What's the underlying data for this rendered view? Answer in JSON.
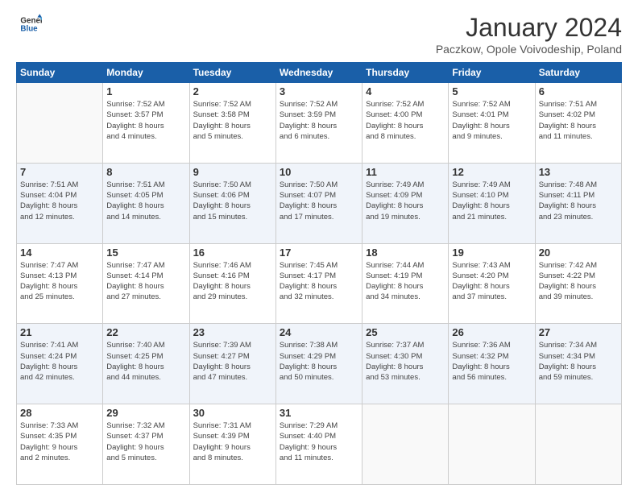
{
  "logo": {
    "general": "General",
    "blue": "Blue"
  },
  "title": "January 2024",
  "subtitle": "Paczkow, Opole Voivodeship, Poland",
  "weekdays": [
    "Sunday",
    "Monday",
    "Tuesday",
    "Wednesday",
    "Thursday",
    "Friday",
    "Saturday"
  ],
  "weeks": [
    [
      {
        "day": "",
        "info": ""
      },
      {
        "day": "1",
        "info": "Sunrise: 7:52 AM\nSunset: 3:57 PM\nDaylight: 8 hours\nand 4 minutes."
      },
      {
        "day": "2",
        "info": "Sunrise: 7:52 AM\nSunset: 3:58 PM\nDaylight: 8 hours\nand 5 minutes."
      },
      {
        "day": "3",
        "info": "Sunrise: 7:52 AM\nSunset: 3:59 PM\nDaylight: 8 hours\nand 6 minutes."
      },
      {
        "day": "4",
        "info": "Sunrise: 7:52 AM\nSunset: 4:00 PM\nDaylight: 8 hours\nand 8 minutes."
      },
      {
        "day": "5",
        "info": "Sunrise: 7:52 AM\nSunset: 4:01 PM\nDaylight: 8 hours\nand 9 minutes."
      },
      {
        "day": "6",
        "info": "Sunrise: 7:51 AM\nSunset: 4:02 PM\nDaylight: 8 hours\nand 11 minutes."
      }
    ],
    [
      {
        "day": "7",
        "info": "Sunrise: 7:51 AM\nSunset: 4:04 PM\nDaylight: 8 hours\nand 12 minutes."
      },
      {
        "day": "8",
        "info": "Sunrise: 7:51 AM\nSunset: 4:05 PM\nDaylight: 8 hours\nand 14 minutes."
      },
      {
        "day": "9",
        "info": "Sunrise: 7:50 AM\nSunset: 4:06 PM\nDaylight: 8 hours\nand 15 minutes."
      },
      {
        "day": "10",
        "info": "Sunrise: 7:50 AM\nSunset: 4:07 PM\nDaylight: 8 hours\nand 17 minutes."
      },
      {
        "day": "11",
        "info": "Sunrise: 7:49 AM\nSunset: 4:09 PM\nDaylight: 8 hours\nand 19 minutes."
      },
      {
        "day": "12",
        "info": "Sunrise: 7:49 AM\nSunset: 4:10 PM\nDaylight: 8 hours\nand 21 minutes."
      },
      {
        "day": "13",
        "info": "Sunrise: 7:48 AM\nSunset: 4:11 PM\nDaylight: 8 hours\nand 23 minutes."
      }
    ],
    [
      {
        "day": "14",
        "info": "Sunrise: 7:47 AM\nSunset: 4:13 PM\nDaylight: 8 hours\nand 25 minutes."
      },
      {
        "day": "15",
        "info": "Sunrise: 7:47 AM\nSunset: 4:14 PM\nDaylight: 8 hours\nand 27 minutes."
      },
      {
        "day": "16",
        "info": "Sunrise: 7:46 AM\nSunset: 4:16 PM\nDaylight: 8 hours\nand 29 minutes."
      },
      {
        "day": "17",
        "info": "Sunrise: 7:45 AM\nSunset: 4:17 PM\nDaylight: 8 hours\nand 32 minutes."
      },
      {
        "day": "18",
        "info": "Sunrise: 7:44 AM\nSunset: 4:19 PM\nDaylight: 8 hours\nand 34 minutes."
      },
      {
        "day": "19",
        "info": "Sunrise: 7:43 AM\nSunset: 4:20 PM\nDaylight: 8 hours\nand 37 minutes."
      },
      {
        "day": "20",
        "info": "Sunrise: 7:42 AM\nSunset: 4:22 PM\nDaylight: 8 hours\nand 39 minutes."
      }
    ],
    [
      {
        "day": "21",
        "info": "Sunrise: 7:41 AM\nSunset: 4:24 PM\nDaylight: 8 hours\nand 42 minutes."
      },
      {
        "day": "22",
        "info": "Sunrise: 7:40 AM\nSunset: 4:25 PM\nDaylight: 8 hours\nand 44 minutes."
      },
      {
        "day": "23",
        "info": "Sunrise: 7:39 AM\nSunset: 4:27 PM\nDaylight: 8 hours\nand 47 minutes."
      },
      {
        "day": "24",
        "info": "Sunrise: 7:38 AM\nSunset: 4:29 PM\nDaylight: 8 hours\nand 50 minutes."
      },
      {
        "day": "25",
        "info": "Sunrise: 7:37 AM\nSunset: 4:30 PM\nDaylight: 8 hours\nand 53 minutes."
      },
      {
        "day": "26",
        "info": "Sunrise: 7:36 AM\nSunset: 4:32 PM\nDaylight: 8 hours\nand 56 minutes."
      },
      {
        "day": "27",
        "info": "Sunrise: 7:34 AM\nSunset: 4:34 PM\nDaylight: 8 hours\nand 59 minutes."
      }
    ],
    [
      {
        "day": "28",
        "info": "Sunrise: 7:33 AM\nSunset: 4:35 PM\nDaylight: 9 hours\nand 2 minutes."
      },
      {
        "day": "29",
        "info": "Sunrise: 7:32 AM\nSunset: 4:37 PM\nDaylight: 9 hours\nand 5 minutes."
      },
      {
        "day": "30",
        "info": "Sunrise: 7:31 AM\nSunset: 4:39 PM\nDaylight: 9 hours\nand 8 minutes."
      },
      {
        "day": "31",
        "info": "Sunrise: 7:29 AM\nSunset: 4:40 PM\nDaylight: 9 hours\nand 11 minutes."
      },
      {
        "day": "",
        "info": ""
      },
      {
        "day": "",
        "info": ""
      },
      {
        "day": "",
        "info": ""
      }
    ]
  ]
}
